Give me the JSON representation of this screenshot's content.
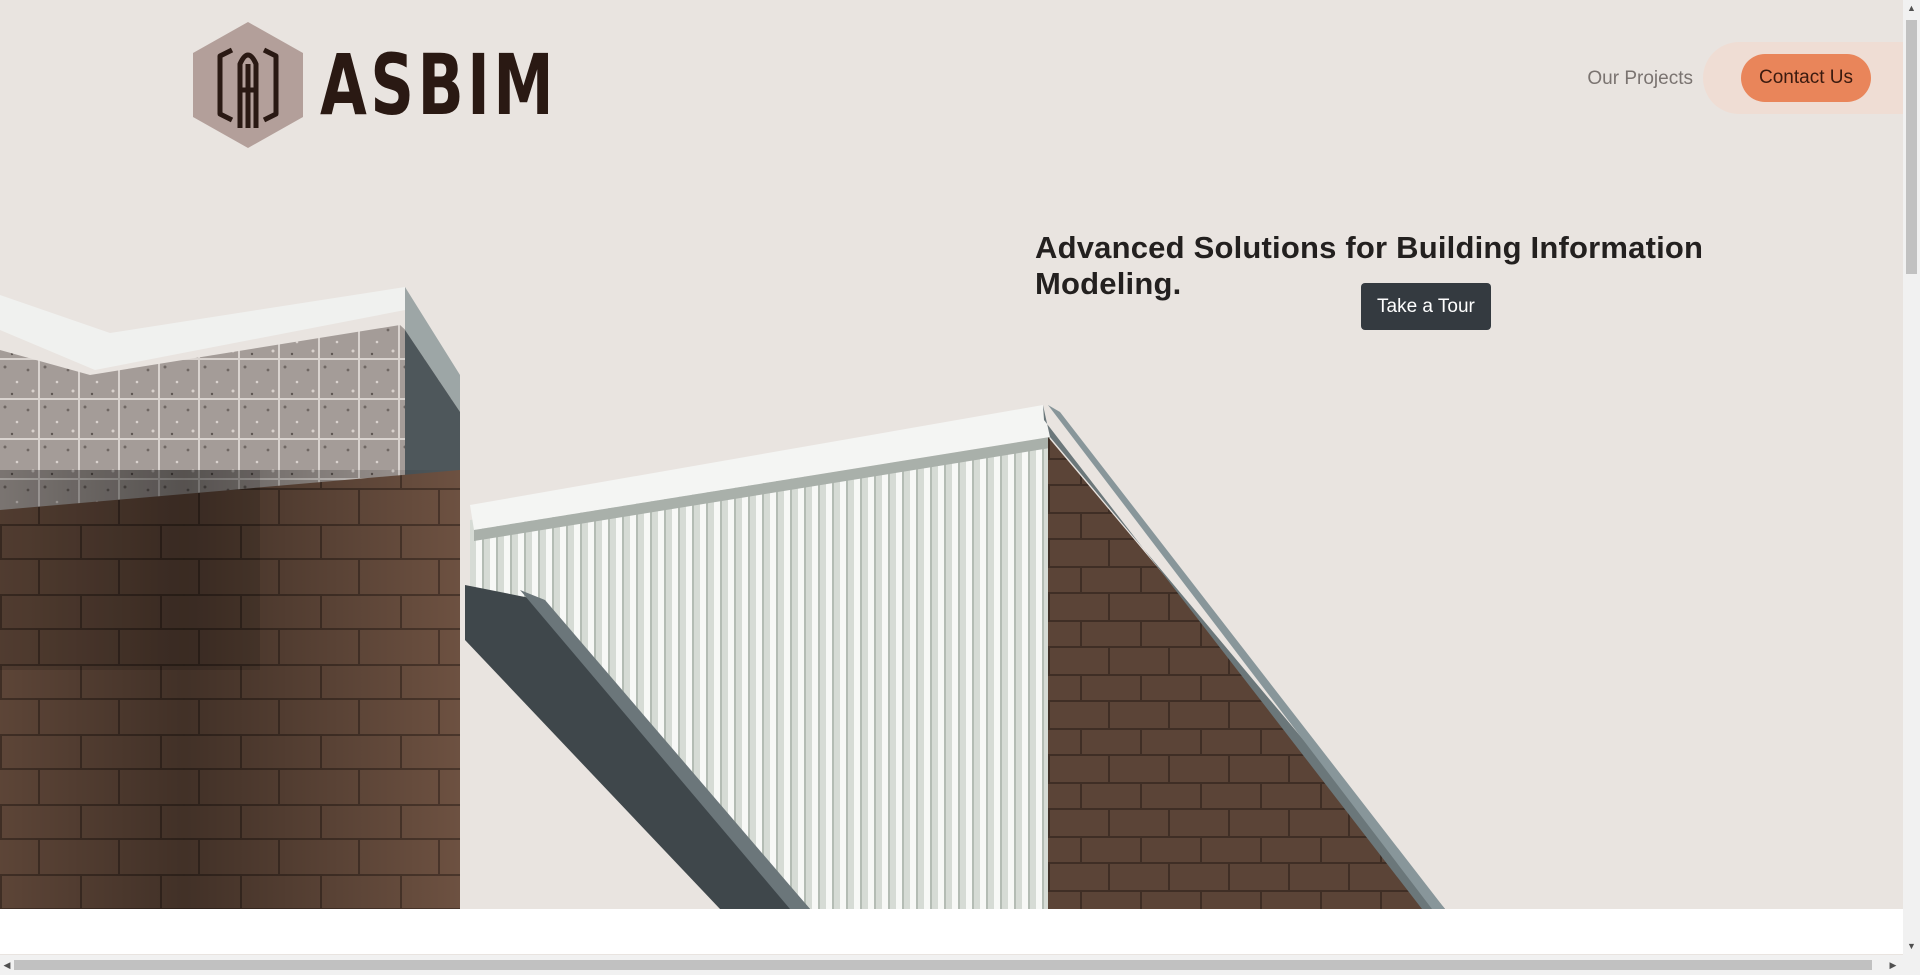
{
  "brand": {
    "name": "ASBIM"
  },
  "nav": {
    "projects_label": "Our Projects",
    "contact_label": "Contact Us"
  },
  "hero": {
    "headline": "Advanced Solutions for Building Information Modeling.",
    "cta_label": "Take a Tour"
  },
  "colors": {
    "background": "#e9e4e0",
    "accent": "#e9855a",
    "accent_pill": "#efddd4",
    "dark_button": "#343a40",
    "brand_text": "#2a1913",
    "logo_hex": "#b39f9a"
  },
  "icons": {
    "logo": "hexagon-monogram-icon",
    "scroll_up": "triangle-up",
    "scroll_down": "triangle-down",
    "scroll_left": "triangle-left",
    "scroll_right": "triangle-right"
  }
}
